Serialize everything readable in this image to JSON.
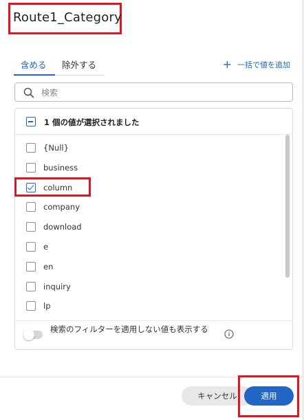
{
  "dialog": {
    "title": "Route1_Category"
  },
  "tabs": {
    "include_label": "含める",
    "exclude_label": "除外する",
    "active": "include"
  },
  "add_bulk": {
    "label": "一括で値を追加"
  },
  "search": {
    "placeholder": "検索",
    "value": ""
  },
  "list": {
    "summary": "1 個の値が選択されました",
    "items": [
      {
        "label": "{Null}",
        "checked": false
      },
      {
        "label": "business",
        "checked": false
      },
      {
        "label": "column",
        "checked": true
      },
      {
        "label": "company",
        "checked": false
      },
      {
        "label": "download",
        "checked": false
      },
      {
        "label": "e",
        "checked": false
      },
      {
        "label": "en",
        "checked": false
      },
      {
        "label": "inquiry",
        "checked": false
      },
      {
        "label": "lp",
        "checked": false
      }
    ]
  },
  "filter_toggle": {
    "label": "検索のフィルターを適用しない値も表示する",
    "on": false
  },
  "footer": {
    "cancel_label": "キャンセル",
    "apply_label": "適用"
  },
  "colors": {
    "accent": "#2166c4",
    "highlight": "#e0161e"
  },
  "icons": {
    "search": "search-icon",
    "plus": "plus-icon",
    "info": "info-icon"
  }
}
